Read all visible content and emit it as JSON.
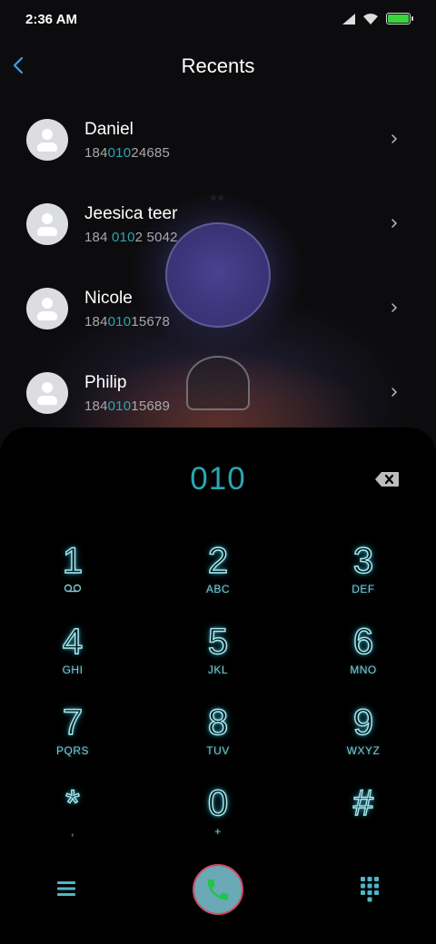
{
  "status_bar": {
    "time": "2:36 AM",
    "icons": [
      "cell-signal-icon",
      "wifi-icon",
      "battery-icon"
    ],
    "battery_color": "#3cd43c"
  },
  "header": {
    "back_icon": "chevron-left-icon",
    "title": "Recents"
  },
  "recents": [
    {
      "name": "Daniel",
      "number_parts": [
        "184",
        "010",
        "24685"
      ]
    },
    {
      "name": "Jeesica teer",
      "number_parts": [
        "184 ",
        "010",
        "2 5042"
      ]
    },
    {
      "name": "Nicole",
      "number_parts": [
        "184",
        "010",
        "15678"
      ]
    },
    {
      "name": "Philip",
      "number_parts": [
        "184",
        "010",
        "15689"
      ]
    }
  ],
  "dialer": {
    "entered_digits": "010",
    "accent_color": "#2aa6b4",
    "keys": [
      {
        "digit": "1",
        "letters": "voicemail-icon"
      },
      {
        "digit": "2",
        "letters": "ABC"
      },
      {
        "digit": "3",
        "letters": "DEF"
      },
      {
        "digit": "4",
        "letters": "GHI"
      },
      {
        "digit": "5",
        "letters": "JKL"
      },
      {
        "digit": "6",
        "letters": "MNO"
      },
      {
        "digit": "7",
        "letters": "PQRS"
      },
      {
        "digit": "8",
        "letters": "TUV"
      },
      {
        "digit": "9",
        "letters": "WXYZ"
      },
      {
        "digit": "*",
        "letters": ","
      },
      {
        "digit": "0",
        "letters": "+"
      },
      {
        "digit": "#",
        "letters": ""
      }
    ],
    "bottom": {
      "menu_icon": "menu-icon",
      "call_icon": "phone-icon",
      "call_button_color": "#6aa9b5",
      "keypad_icon": "keypad-grid-icon"
    }
  }
}
